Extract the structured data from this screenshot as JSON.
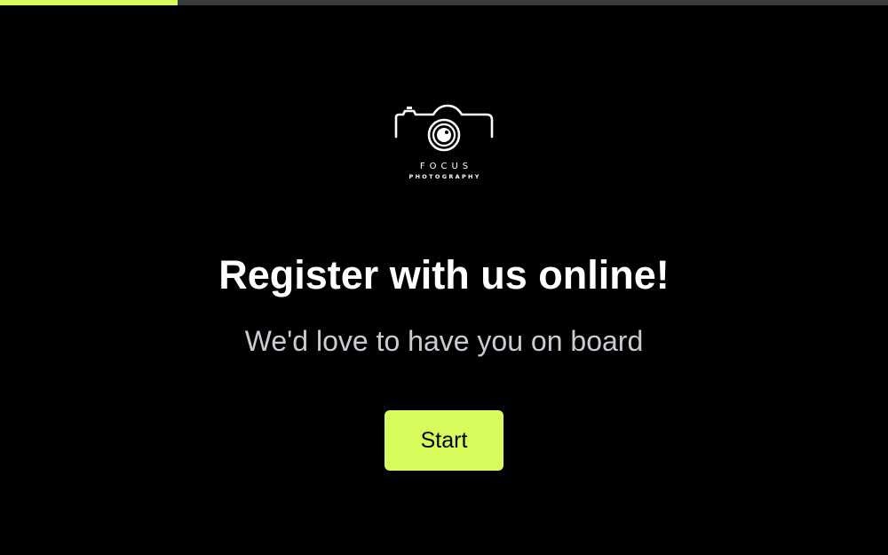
{
  "progress": {
    "percent": 20,
    "fill_color": "#d8fb5c",
    "track_color": "#3a3a3a"
  },
  "logo": {
    "icon": "camera-icon",
    "word_top": "FOCUS",
    "word_bottom": "PHOTOGRAPHY"
  },
  "main": {
    "title": "Register with us online!",
    "subtitle": "We'd love to have you on board",
    "start_label": "Start"
  },
  "colors": {
    "background": "#000000",
    "accent": "#d8fb5c",
    "subtitle": "#c9ccd2"
  }
}
